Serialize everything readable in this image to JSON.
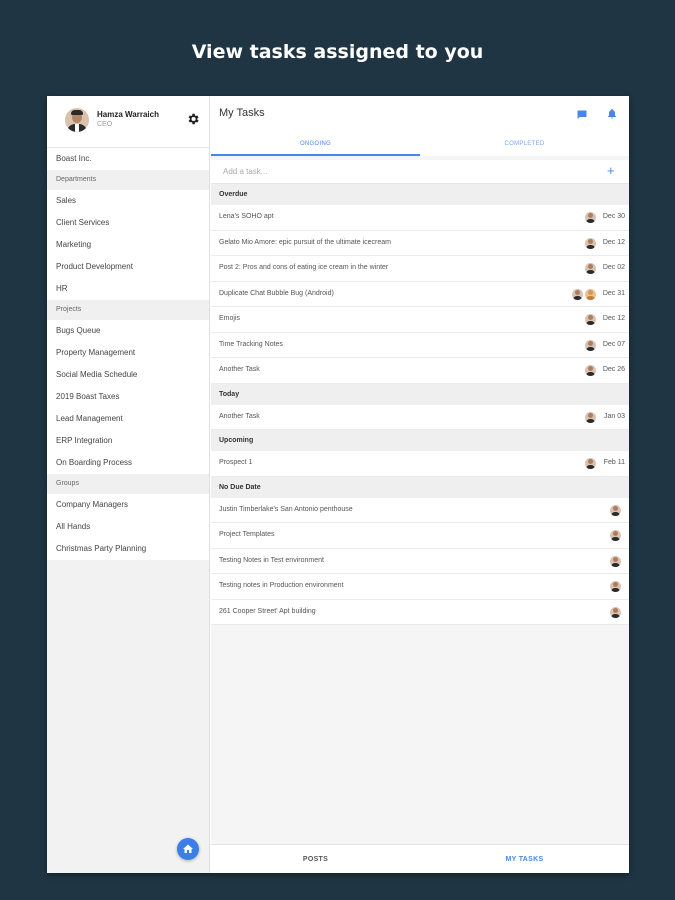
{
  "headline": "View tasks assigned to you",
  "profile": {
    "name": "Hamza Warraich",
    "role": "CEO"
  },
  "sidebar": {
    "items": [
      {
        "label": "Boast Inc.",
        "kind": "item"
      },
      {
        "label": "Departments",
        "kind": "header"
      },
      {
        "label": "Sales",
        "kind": "item"
      },
      {
        "label": "Client Services",
        "kind": "item"
      },
      {
        "label": "Marketing",
        "kind": "item"
      },
      {
        "label": "Product Development",
        "kind": "item"
      },
      {
        "label": "HR",
        "kind": "item"
      },
      {
        "label": "Projects",
        "kind": "header"
      },
      {
        "label": "Bugs Queue",
        "kind": "item"
      },
      {
        "label": "Property Management",
        "kind": "item"
      },
      {
        "label": "Social Media Schedule",
        "kind": "item"
      },
      {
        "label": "2019 Boast Taxes",
        "kind": "item"
      },
      {
        "label": "Lead Management",
        "kind": "item"
      },
      {
        "label": "ERP Integration",
        "kind": "item"
      },
      {
        "label": "On Boarding Process",
        "kind": "item"
      },
      {
        "label": "Groups",
        "kind": "header"
      },
      {
        "label": "Company Managers",
        "kind": "item"
      },
      {
        "label": "All Hands",
        "kind": "item"
      },
      {
        "label": "Christmas Party Planning",
        "kind": "item"
      }
    ]
  },
  "main": {
    "title": "My Tasks",
    "tabs": [
      {
        "label": "ONGOING",
        "active": true
      },
      {
        "label": "COMPLETED",
        "active": false
      }
    ],
    "add_placeholder": "Add a task...",
    "sections": [
      {
        "title": "Overdue",
        "tasks": [
          {
            "title": "Lena's SOHO apt",
            "date": "Dec 30",
            "assignees": 1
          },
          {
            "title": "Gelato Mio Amore: epic pursuit of the ultimate icecream",
            "date": "Dec 12",
            "assignees": 1
          },
          {
            "title": "Post 2: Pros and cons of eating ice cream in the winter",
            "date": "Dec 02",
            "assignees": 1
          },
          {
            "title": "Duplicate Chat Bubble Bug (Android)",
            "date": "Dec 31",
            "assignees": 2
          },
          {
            "title": "Emojis",
            "date": "Dec 12",
            "assignees": 1
          },
          {
            "title": "Time Tracking Notes",
            "date": "Dec 07",
            "assignees": 1
          },
          {
            "title": "Another Task",
            "date": "Dec 26",
            "assignees": 1
          }
        ]
      },
      {
        "title": "Today",
        "tasks": [
          {
            "title": "Another Task",
            "date": "Jan 03",
            "assignees": 1
          }
        ]
      },
      {
        "title": "Upcoming",
        "tasks": [
          {
            "title": "Prospect 1",
            "date": "Feb 11",
            "assignees": 1
          }
        ]
      },
      {
        "title": "No Due Date",
        "tasks": [
          {
            "title": "Justin Timberlake's San Antonio penthouse",
            "date": "",
            "assignees": 1
          },
          {
            "title": "Project Templates",
            "date": "",
            "assignees": 1
          },
          {
            "title": "Testing Notes in Test environment",
            "date": "",
            "assignees": 1
          },
          {
            "title": "Testing notes in Production environment",
            "date": "",
            "assignees": 1
          },
          {
            "title": "261 Cooper Street' Apt building",
            "date": "",
            "assignees": 1
          }
        ]
      }
    ]
  },
  "bottom_nav": {
    "items": [
      {
        "label": "POSTS",
        "active": false
      },
      {
        "label": "MY TASKS",
        "active": true
      }
    ]
  },
  "colors": {
    "accent": "#4a86e8",
    "background": "#1f3544"
  },
  "icons": [
    "settings-gear-icon",
    "chat-icon",
    "bell-icon",
    "plus-icon",
    "home-icon"
  ]
}
